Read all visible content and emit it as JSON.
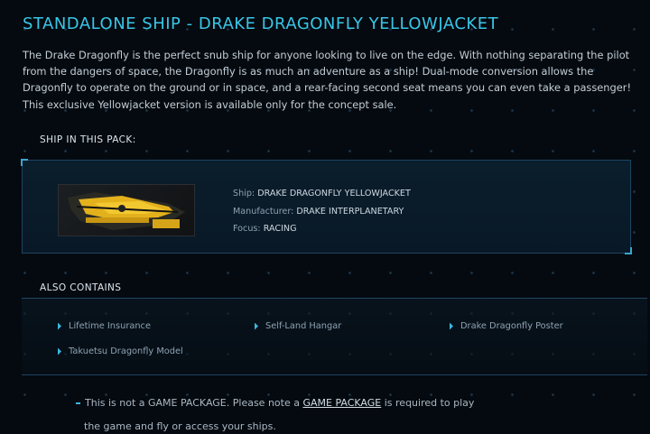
{
  "header": {
    "title": "STANDALONE SHIP - DRAKE DRAGONFLY YELLOWJACKET"
  },
  "description": "The Drake Dragonfly is the perfect snub ship for anyone looking to live on the edge. With nothing separating the pilot from the dangers of space, the Dragonfly is as much an adventure as a ship! Dual-mode conversion allows the Dragonfly to operate on the ground or in space, and a rear-facing second seat means you can even take a passenger! This exclusive Yellowjacket version is available only for the concept sale.",
  "ship_section": {
    "label": "SHIP IN THIS PACK:",
    "ship_label": "Ship:",
    "ship_value": "DRAKE DRAGONFLY YELLOWJACKET",
    "manufacturer_label": "Manufacturer:",
    "manufacturer_value": "DRAKE INTERPLANETARY",
    "focus_label": "Focus:",
    "focus_value": "RACING"
  },
  "also_contains": {
    "label": "ALSO CONTAINS",
    "items": [
      "Lifetime Insurance",
      "Self-Land Hangar",
      "Drake Dragonfly Poster",
      "Takuetsu Dragonfly Model"
    ]
  },
  "note": {
    "prefix": "This is not a GAME PACKAGE. Please note a ",
    "link": "GAME PACKAGE",
    "suffix": " is required to play",
    "line2": "the game and fly or access your ships."
  },
  "colors": {
    "accent": "#39c6e6",
    "background": "#050a10",
    "panel_border": "#1d4560"
  }
}
